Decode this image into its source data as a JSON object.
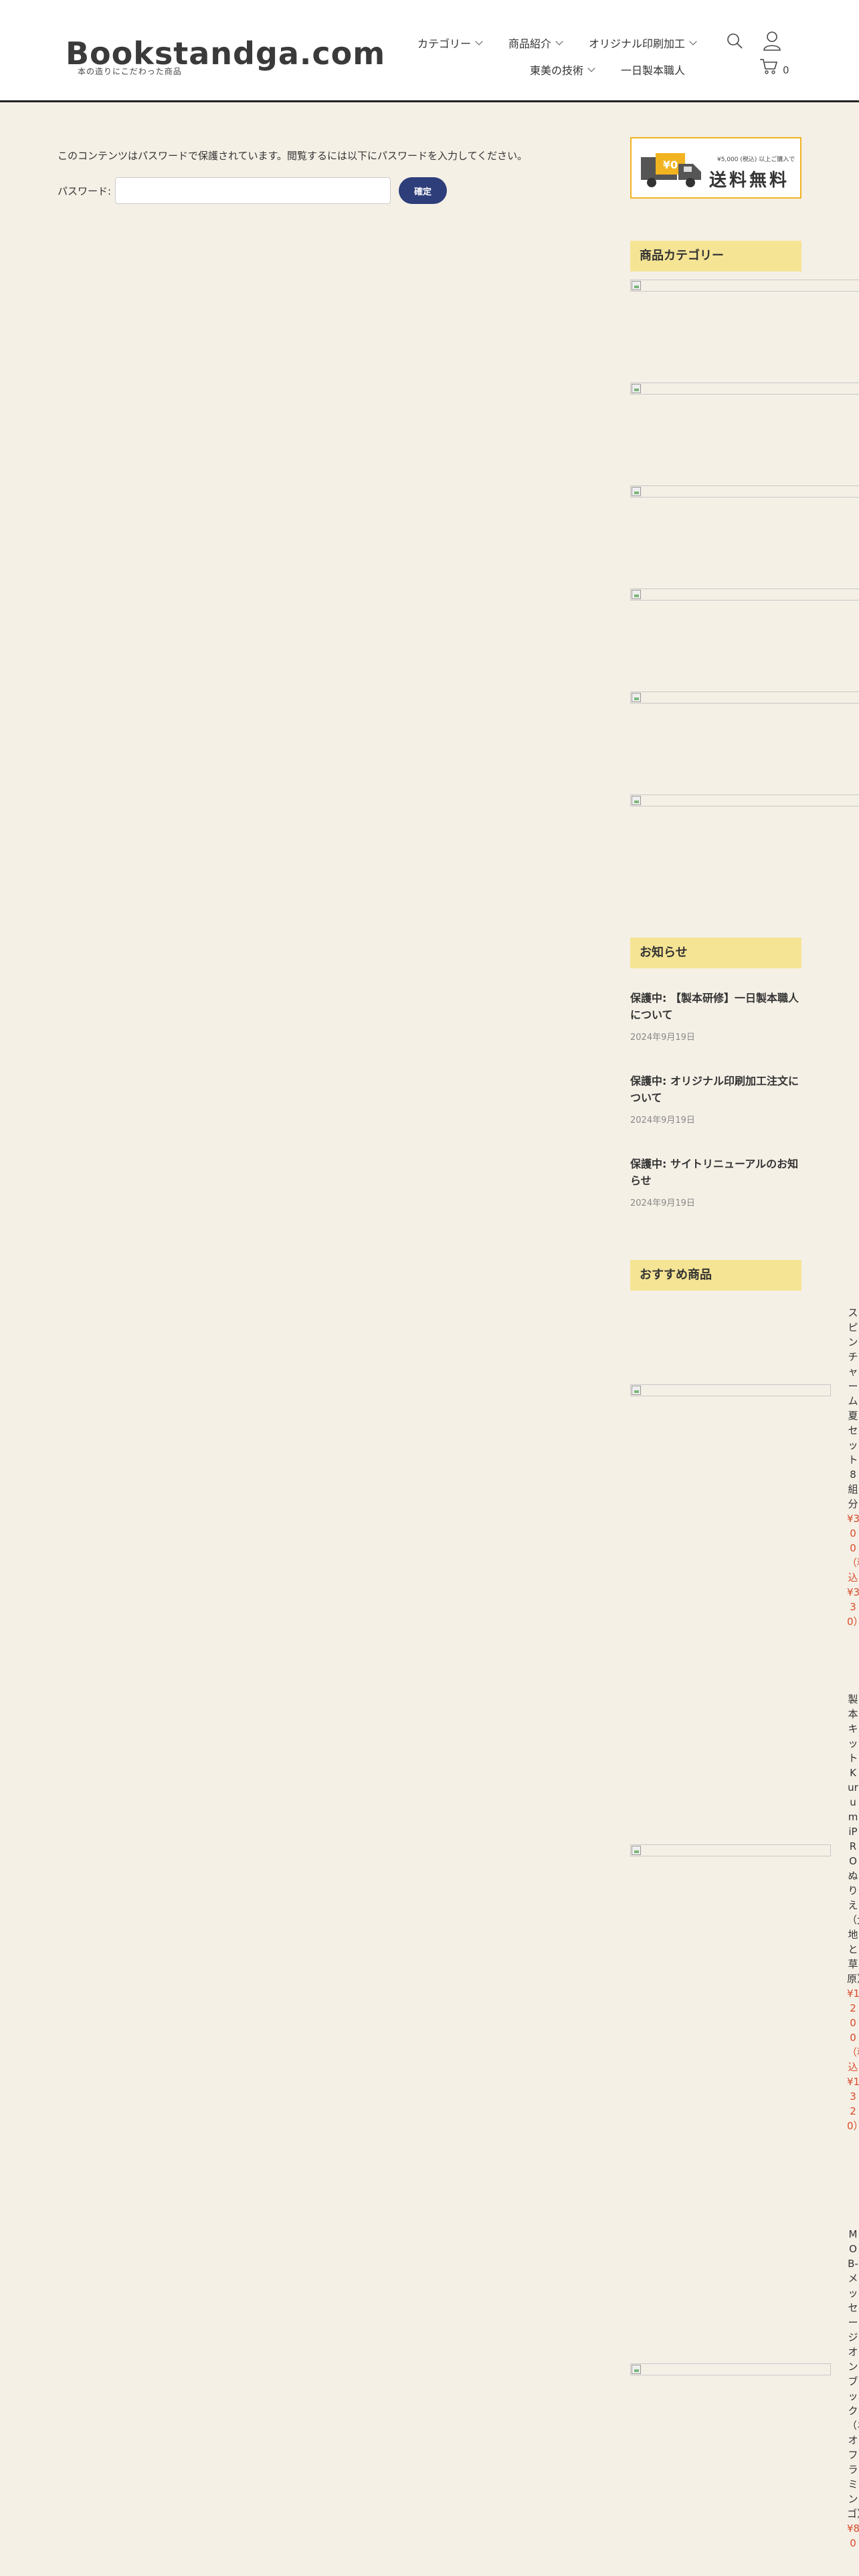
{
  "header": {
    "logo_text": "Bookstandga.com",
    "logo_tagline": "本の造りにこだわった商品",
    "nav_row1": [
      {
        "label": "カテゴリー",
        "dropdown": true
      },
      {
        "label": "商品紹介",
        "dropdown": true
      },
      {
        "label": "オリジナル印刷加工",
        "dropdown": true
      }
    ],
    "nav_row2": [
      {
        "label": "東美の技術",
        "dropdown": true
      },
      {
        "label": "一日製本職人",
        "dropdown": false
      }
    ],
    "cart_count": "0"
  },
  "main": {
    "notice": "このコンテンツはパスワードで保護されています。閲覧するには以下にパスワードを入力してください。",
    "password_label": "パスワード:",
    "password_value": "",
    "submit_label": "確定"
  },
  "sidebar": {
    "banner": {
      "badge": "¥0",
      "small_text": "¥5,000 (税込) 以上ご購入で",
      "big_text": "送料無料"
    },
    "category_title": "商品カテゴリー",
    "category_image_count": 6,
    "news_title": "お知らせ",
    "news": [
      {
        "title": "保護中: 【製本研修】一日製本職人について",
        "date": "2024年9月19日"
      },
      {
        "title": "保護中: オリジナル印刷加工注文について",
        "date": "2024年9月19日"
      },
      {
        "title": "保護中: サイトリニューアルのお知らせ",
        "date": "2024年9月19日"
      }
    ],
    "recommended_title": "おすすめ商品",
    "recommended": [
      {
        "name": "スピンチャーム夏セット8組分",
        "price": "¥300",
        "tax_note": "（税込¥330）"
      },
      {
        "name": "製本キットKurumiPROぬりえ（大地と草原）",
        "price": "¥1,200",
        "tax_note": "（税込¥1,320）"
      },
      {
        "name": "MOB-メッセージオンブック（ネオフラミンゴ）",
        "price": "¥80",
        "tax_note": ""
      }
    ]
  },
  "colors": {
    "background": "#f5f0e6",
    "header_bg": "#ffffff",
    "section_title_bg": "#f5e494",
    "button": "#2e3e7a",
    "price": "#d94a2a",
    "banner_border": "#f2b320"
  }
}
